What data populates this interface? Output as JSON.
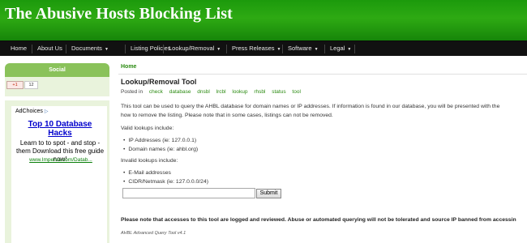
{
  "site": {
    "title": "The Abusive Hosts Blocking List"
  },
  "nav": [
    {
      "label": "Home",
      "has_dropdown": false
    },
    {
      "label": "About Us",
      "has_dropdown": false
    },
    {
      "label": "Documents",
      "has_dropdown": true
    },
    {
      "label": "Listing Policies",
      "has_dropdown": false
    },
    {
      "label": "Lookup/Removal",
      "has_dropdown": true
    },
    {
      "label": "Press Releases",
      "has_dropdown": true
    },
    {
      "label": "Software",
      "has_dropdown": true
    },
    {
      "label": "Legal",
      "has_dropdown": true
    }
  ],
  "sidebar": {
    "social_title": "Social",
    "gplus_label": "+1",
    "gplus_count": "12",
    "ad": {
      "adchoices": "AdChoices",
      "headline": "Top 10 Database Hacks",
      "body": "Learn to to spot - and stop - them Download this free guide now!",
      "url": "www.Imperva.com/Datab..."
    }
  },
  "breadcrumb": "Home",
  "page": {
    "title": "Lookup/Removal Tool",
    "posted_in": "Posted in",
    "tags": [
      "check",
      "database",
      "dnsbl",
      "lrcbl",
      "lookup",
      "rhsbl",
      "status",
      "tool"
    ],
    "intro_line1": "This tool can be used to query the AHBL database for domain names or IP addresses. If information is found in our database, you will be presented with the",
    "intro_line2": "how to remove the listing. Please note that in some cases, listings can not be removed.",
    "valid_heading": "Valid lookups include:",
    "valid_items": [
      "IP Addresses (ie: 127.0.0.1)",
      "Domain names (ie: ahbl.org)"
    ],
    "invalid_heading": "Invalid lookups include:",
    "invalid_items": [
      "E-Mail addresses",
      "CIDR/Netmask (ie: 127.0.0.0/24)"
    ],
    "query_value": "",
    "submit_label": "Submit",
    "notice": "Please note that accesses to this tool are logged and reviewed. Abuse or automated querying will not be tolerated and source IP banned from accessin",
    "footer_note": "AHBL Advanced Query Tool v4.1"
  },
  "colors": {
    "header_green": "#2eaa13",
    "nav_bg": "#111111",
    "link_green": "#2a8a10",
    "sidebar_bg": "#e9f3dc"
  }
}
